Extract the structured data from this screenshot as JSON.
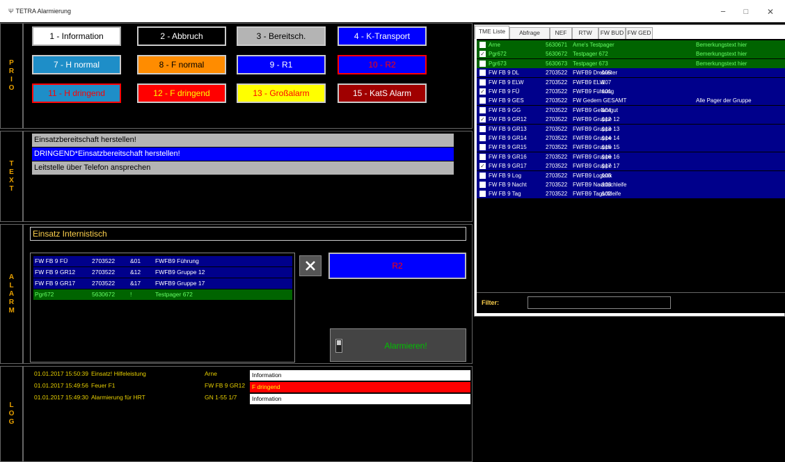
{
  "window": {
    "title": "TETRA Alarmierung",
    "icon": "app-icon",
    "controls": {
      "minimize": "−",
      "maximize": "□",
      "close": "✕"
    }
  },
  "side_labels": {
    "prio": "PRIO",
    "text": "TEXT",
    "alarm": "ALARM",
    "log": "LOG"
  },
  "prio_buttons": [
    {
      "label": "1 - Information",
      "bg": "#ffffff",
      "fg": "#000000",
      "border": "#aaaaaa"
    },
    {
      "label": "2 - Abbruch",
      "bg": "#000000",
      "fg": "#ffffff",
      "border": "#cccccc"
    },
    {
      "label": "3 - Bereitsch.",
      "bg": "#b4b4b4",
      "fg": "#000000",
      "border": "#cccccc"
    },
    {
      "label": "4 - K-Transport",
      "bg": "#0000ff",
      "fg": "#ffffff",
      "border": "#cccccc"
    },
    {
      "label": "7 - H normal",
      "bg": "#1e8ec8",
      "fg": "#ffffff",
      "border": "#cccccc"
    },
    {
      "label": "8 - F normal",
      "bg": "#ff8c00",
      "fg": "#000000",
      "border": "#cccccc"
    },
    {
      "label": "9 - R1",
      "bg": "#0000ff",
      "fg": "#ffffff",
      "border": "#cccccc"
    },
    {
      "label": "10 - R2",
      "bg": "#0000ff",
      "fg": "#ff0000",
      "border": "#ff0000"
    },
    {
      "label": "11 - H dringend",
      "bg": "#1e8ec8",
      "fg": "#ff0000",
      "border": "#ff0000"
    },
    {
      "label": "12 - F dringend",
      "bg": "#ff0000",
      "fg": "#ffff00",
      "border": "#cccccc"
    },
    {
      "label": "13 - Großalarm",
      "bg": "#ffff00",
      "fg": "#ff0000",
      "border": "#cccccc"
    },
    {
      "label": "15 - KatS Alarm",
      "bg": "#a00000",
      "fg": "#ffffff",
      "border": "#cccccc"
    }
  ],
  "text_rows": [
    {
      "text": "Einsatzbereitschaft herstellen!",
      "bg": "#b4b4b4",
      "fg": "#000000"
    },
    {
      "text": "DRINGEND*Einsatzbereitschaft herstellen!",
      "bg": "#0000ff",
      "fg": "#ffffff"
    },
    {
      "text": "Leitstelle über Telefon ansprechen",
      "bg": "#b4b4b4",
      "fg": "#000000"
    }
  ],
  "alarm": {
    "einsatz_value": "Einsatz Internistisch",
    "selected_list": [
      {
        "name": "FW FB 9 FÜ",
        "nr": "2703522",
        "sub": "&01",
        "desc": "FWFB9 Führung",
        "bg": "#00008b"
      },
      {
        "name": "FW FB 9 GR12",
        "nr": "2703522",
        "sub": "&12",
        "desc": "FWFB9 Gruppe 12",
        "bg": "#00008b"
      },
      {
        "name": "FW FB 9 GR17",
        "nr": "2703522",
        "sub": "&17",
        "desc": "FWFB9 Gruppe 17",
        "bg": "#00008b"
      },
      {
        "name": "Pgr672",
        "nr": "5630672",
        "sub": "!",
        "desc": "Testpager 672",
        "bg": "#006400"
      }
    ],
    "clear_icon": "close-x-icon",
    "prio_display": "R2",
    "alarm_button": "Alarmieren!",
    "switch_icon": "toggle-switch-icon"
  },
  "log": [
    {
      "time": "01.01.2017 15:50:39",
      "event": "Einsatz! Hilfeleistung",
      "target": "Arne",
      "prio": "Information",
      "bg": "#ffffff",
      "fg": "#000000"
    },
    {
      "time": "01.01.2017 15:49:56",
      "event": "Feuer F1",
      "target": "FW FB 9 GR12",
      "prio": "F dringend",
      "bg": "#ff0000",
      "fg": "#ffff00"
    },
    {
      "time": "01.01.2017 15:49:30",
      "event": "Alarmierung für HRT",
      "target": "GN 1-55 1/7",
      "prio": "Information",
      "bg": "#ffffff",
      "fg": "#000000"
    }
  ],
  "tabs": [
    "TME Liste",
    "Abfrage",
    "NEF",
    "RTW",
    "FW BUD",
    "FW GED"
  ],
  "tme_list": [
    {
      "checked": false,
      "name": "Arne",
      "nr": "5630671",
      "sub": "",
      "desc": "Arne's Testpager",
      "remark": "Bemerkungstext hier",
      "bg": "#006400",
      "fg": "#66ff66"
    },
    {
      "checked": true,
      "name": "Pgr672",
      "nr": "5630672",
      "sub": "",
      "desc": "Testpager 672",
      "remark": "Bemerkungstext hier",
      "bg": "#006400",
      "fg": "#66ff66"
    },
    {
      "checked": false,
      "name": "Pgr673",
      "nr": "5630673",
      "sub": "",
      "desc": "Testpager 673",
      "remark": "Bemerkungstext hier",
      "bg": "#006400",
      "fg": "#66ff66"
    },
    {
      "checked": false,
      "name": "FW FB 9 DL",
      "nr": "2703522",
      "sub": "&05",
      "desc": "FWFB9 Drehleiter",
      "remark": "",
      "bg": "#00008b",
      "fg": "#ffffff"
    },
    {
      "checked": false,
      "name": "FW FB 9 ELW",
      "nr": "2703522",
      "sub": "&07",
      "desc": "FWFB9 ELW",
      "remark": "",
      "bg": "#00008b",
      "fg": "#ffffff"
    },
    {
      "checked": true,
      "name": "FW FB 9 FÜ",
      "nr": "2703522",
      "sub": "&01",
      "desc": "FWFB9 Führung",
      "remark": "",
      "bg": "#00008b",
      "fg": "#ffffff"
    },
    {
      "checked": false,
      "name": "FW FB 9 GES",
      "nr": "2703522",
      "sub": "",
      "desc": "FW Gedern GESAMT",
      "remark": "Alle Pager der Gruppe",
      "bg": "#00008b",
      "fg": "#ffffff"
    },
    {
      "checked": false,
      "name": "FW FB 9 GG",
      "nr": "2703522",
      "sub": "&04",
      "desc": "FWFB9 Gefahrgut",
      "remark": "",
      "bg": "#00008b",
      "fg": "#ffffff"
    },
    {
      "checked": true,
      "name": "FW FB 9 GR12",
      "nr": "2703522",
      "sub": "&12",
      "desc": "FWFB9 Gruppe 12",
      "remark": "",
      "bg": "#00008b",
      "fg": "#ffffff"
    },
    {
      "checked": false,
      "name": "FW FB 9 GR13",
      "nr": "2703522",
      "sub": "&13",
      "desc": "FWFB9 Gruppe 13",
      "remark": "",
      "bg": "#00008b",
      "fg": "#ffffff"
    },
    {
      "checked": false,
      "name": "FW FB 9 GR14",
      "nr": "2703522",
      "sub": "&14",
      "desc": "FWFB9 Gruppe 14",
      "remark": "",
      "bg": "#00008b",
      "fg": "#ffffff"
    },
    {
      "checked": false,
      "name": "FW FB 9 GR15",
      "nr": "2703522",
      "sub": "&15",
      "desc": "FWFB9 Gruppe 15",
      "remark": "",
      "bg": "#00008b",
      "fg": "#ffffff"
    },
    {
      "checked": false,
      "name": "FW FB 9 GR16",
      "nr": "2703522",
      "sub": "&16",
      "desc": "FWFB9 Gruppe 16",
      "remark": "",
      "bg": "#00008b",
      "fg": "#ffffff"
    },
    {
      "checked": true,
      "name": "FW FB 9 GR17",
      "nr": "2703522",
      "sub": "&17",
      "desc": "FWFB9 Gruppe 17",
      "remark": "",
      "bg": "#00008b",
      "fg": "#ffffff"
    },
    {
      "checked": false,
      "name": "FW FB 9 Log",
      "nr": "2703522",
      "sub": "&06",
      "desc": "FWFB9 Logistik",
      "remark": "",
      "bg": "#00008b",
      "fg": "#ffffff"
    },
    {
      "checked": false,
      "name": "FW FB 9 Nacht",
      "nr": "2703522",
      "sub": "&03",
      "desc": "FWFB9 Nachtschleife",
      "remark": "",
      "bg": "#00008b",
      "fg": "#ffffff"
    },
    {
      "checked": false,
      "name": "FW FB 9 Tag",
      "nr": "2703522",
      "sub": "&02",
      "desc": "FWFB9 Tagschleife",
      "remark": "",
      "bg": "#00008b",
      "fg": "#ffffff"
    }
  ],
  "filter": {
    "label": "Filter:",
    "value": ""
  }
}
